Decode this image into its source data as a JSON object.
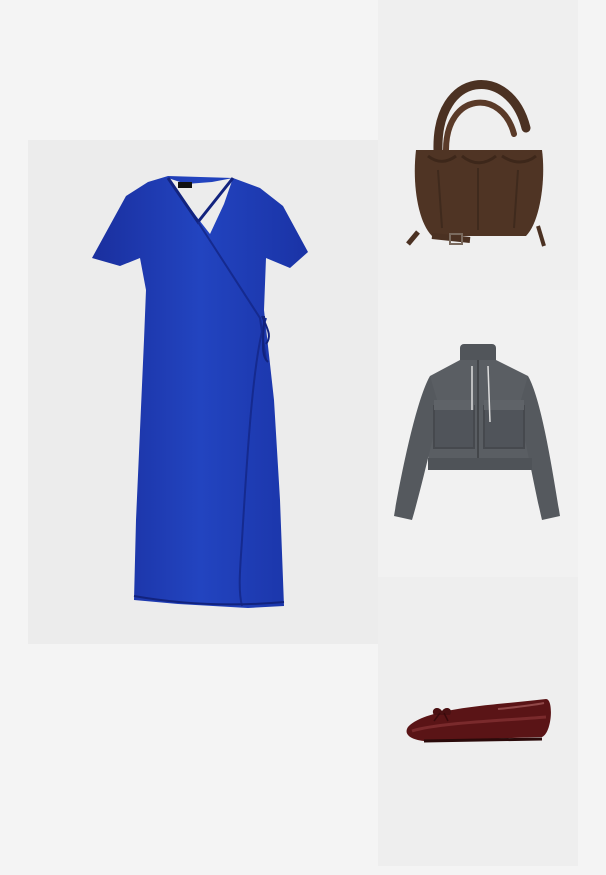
{
  "board": {
    "background": "#f4f4f4",
    "items": [
      {
        "kind": "dress",
        "color": "#1b37b0"
      },
      {
        "kind": "bag",
        "color": "#4f3424"
      },
      {
        "kind": "jacket",
        "color": "#5a5e63"
      },
      {
        "kind": "shoe",
        "color": "#5a1416"
      }
    ]
  }
}
